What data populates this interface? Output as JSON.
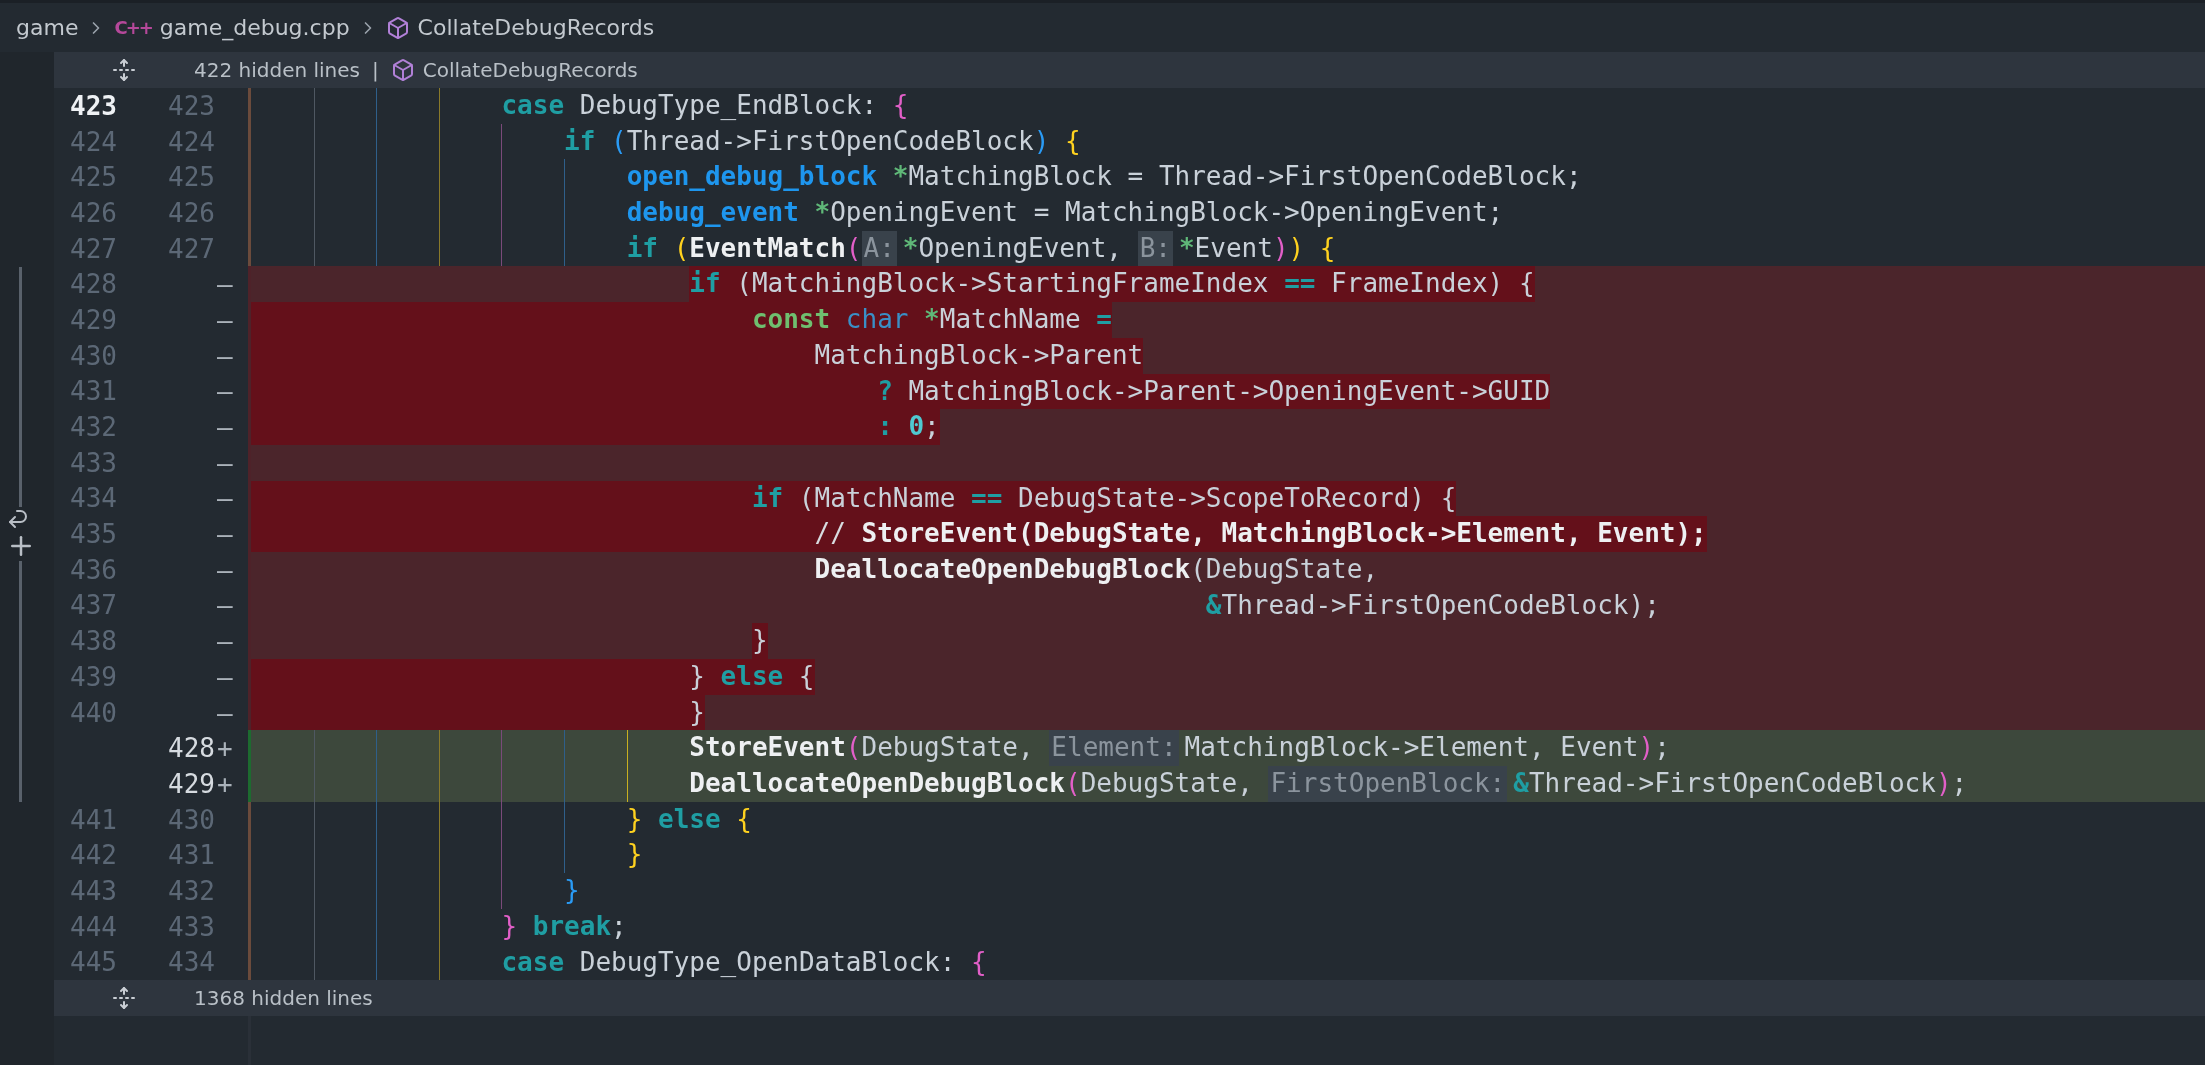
{
  "breadcrumbs": [
    {
      "kind": "folder",
      "text": "game"
    },
    {
      "kind": "file",
      "icon_text": "C++",
      "text": "game_debug.cpp"
    },
    {
      "kind": "symbol",
      "text": "CollateDebugRecords"
    }
  ],
  "top_fold": {
    "label": "422 hidden lines",
    "separator": "|",
    "symbol": "CollateDebugRecords"
  },
  "lines": [
    {
      "kind": "context",
      "old": "423",
      "new": "423",
      "active": true,
      "code": [
        {
          "kind": "keyword",
          "text": "                case"
        },
        {
          "kind": "plain",
          "text": " DebugType_EndBlock: "
        },
        {
          "kind": "bracket-2",
          "text": "{"
        }
      ]
    },
    {
      "kind": "context",
      "old": "424",
      "new": "424",
      "active": false,
      "code": [
        {
          "kind": "keyword",
          "text": "                    if "
        },
        {
          "kind": "bracket-3",
          "text": "("
        },
        {
          "kind": "plain",
          "text": "Thread->FirstOpenCodeBlock"
        },
        {
          "kind": "bracket-3",
          "text": ") "
        },
        {
          "kind": "bracket-1",
          "text": "{"
        }
      ]
    },
    {
      "kind": "context",
      "old": "425",
      "new": "425",
      "active": false,
      "code": [
        {
          "kind": "type",
          "text": "                        open_debug_block "
        },
        {
          "kind": "pointer",
          "text": "*"
        },
        {
          "kind": "plain",
          "text": "MatchingBlock = Thread->FirstOpenCodeBlock;"
        }
      ]
    },
    {
      "kind": "context",
      "old": "426",
      "new": "426",
      "active": false,
      "code": [
        {
          "kind": "type",
          "text": "                        debug_event "
        },
        {
          "kind": "pointer",
          "text": "*"
        },
        {
          "kind": "plain",
          "text": "OpeningEvent = MatchingBlock->OpeningEvent;"
        }
      ]
    },
    {
      "kind": "context",
      "old": "427",
      "new": "427",
      "active": false,
      "code": [
        {
          "kind": "keyword",
          "text": "                        if "
        },
        {
          "kind": "bracket-1",
          "text": "("
        },
        {
          "kind": "function",
          "text": "EventMatch"
        },
        {
          "kind": "bracket-2",
          "text": "("
        },
        {
          "kind": "hint",
          "text": "A:"
        },
        {
          "kind": "pointer",
          "text": "*"
        },
        {
          "kind": "plain",
          "text": "OpeningEvent, "
        },
        {
          "kind": "hint",
          "text": "B:"
        },
        {
          "kind": "pointer",
          "text": "*"
        },
        {
          "kind": "plain",
          "text": "Event"
        },
        {
          "kind": "bracket-2",
          "text": ")"
        },
        {
          "kind": "bracket-1",
          "text": ") {"
        }
      ]
    },
    {
      "kind": "removed",
      "old": "428",
      "sign": "—",
      "active": false,
      "indent_changed": false,
      "code": [
        {
          "kind": "keyword",
          "text": "                            if",
          "changed": true
        },
        {
          "kind": "plain",
          "text": " (MatchingBlock->StartingFrameIndex ",
          "changed": true
        },
        {
          "kind": "operator",
          "text": "==",
          "changed": true
        },
        {
          "kind": "plain",
          "text": " FrameIndex) {",
          "changed": true
        }
      ]
    },
    {
      "kind": "removed",
      "old": "429",
      "sign": "—",
      "active": false,
      "indent_changed": true,
      "code": [
        {
          "kind": "storage",
          "text": "                                const ",
          "changed": true
        },
        {
          "kind": "type-plain",
          "text": "char ",
          "changed": true
        },
        {
          "kind": "pointer",
          "text": "*",
          "changed": true
        },
        {
          "kind": "plain",
          "text": "MatchName ",
          "changed": true
        },
        {
          "kind": "operator",
          "text": "=",
          "changed": true
        }
      ]
    },
    {
      "kind": "removed",
      "old": "430",
      "sign": "—",
      "active": false,
      "indent_changed": true,
      "code": [
        {
          "kind": "plain",
          "text": "                                    MatchingBlock->Parent",
          "changed": true
        }
      ]
    },
    {
      "kind": "removed",
      "old": "431",
      "sign": "—",
      "active": false,
      "indent_changed": true,
      "code": [
        {
          "kind": "operator",
          "text": "                                        ?",
          "changed": true
        },
        {
          "kind": "plain",
          "text": " MatchingBlock->Parent->OpeningEvent->GUID",
          "changed": true
        }
      ]
    },
    {
      "kind": "removed",
      "old": "432",
      "sign": "—",
      "active": false,
      "indent_changed": true,
      "code": [
        {
          "kind": "operator",
          "text": "                                        : ",
          "changed": true
        },
        {
          "kind": "number",
          "text": "0",
          "changed": true
        },
        {
          "kind": "plain",
          "text": ";",
          "changed": true
        }
      ]
    },
    {
      "kind": "removed",
      "old": "433",
      "sign": "—",
      "active": false
    },
    {
      "kind": "removed",
      "old": "434",
      "sign": "—",
      "active": false,
      "indent_changed": true,
      "code": [
        {
          "kind": "keyword",
          "text": "                                if",
          "changed": true
        },
        {
          "kind": "plain",
          "text": " (MatchName ",
          "changed": true
        },
        {
          "kind": "operator",
          "text": "==",
          "changed": true
        },
        {
          "kind": "plain",
          "text": " DebugState->ScopeToRecord) {",
          "changed": true
        }
      ]
    },
    {
      "kind": "removed",
      "old": "435",
      "sign": "—",
      "active": false,
      "indent_changed": true,
      "code": [
        {
          "kind": "comment",
          "text": "                                    // ",
          "changed": true
        },
        {
          "kind": "function",
          "text": "StoreEvent(DebugState, MatchingBlock->Element, Event);",
          "changed": true
        }
      ]
    },
    {
      "kind": "removed",
      "old": "436",
      "sign": "—",
      "active": false,
      "indent_changed": false,
      "code": [
        {
          "kind": "function",
          "text": "                                    DeallocateOpenDebugBlock",
          "changed": false
        },
        {
          "kind": "plain",
          "text": "(DebugState,",
          "changed": false
        }
      ]
    },
    {
      "kind": "removed",
      "old": "437",
      "sign": "—",
      "active": false,
      "indent_changed": false,
      "code": [
        {
          "kind": "operator",
          "text": "                                                             &",
          "changed": false
        },
        {
          "kind": "plain",
          "text": "Thread->FirstOpenCodeBlock);",
          "changed": false
        }
      ]
    },
    {
      "kind": "removed",
      "old": "438",
      "sign": "—",
      "active": false,
      "indent_changed": false,
      "code": [
        {
          "kind": "plain",
          "text": "                                }",
          "changed": true
        }
      ]
    },
    {
      "kind": "removed",
      "old": "439",
      "sign": "—",
      "active": false,
      "indent_changed": true,
      "code": [
        {
          "kind": "plain",
          "text": "                            } ",
          "changed": true
        },
        {
          "kind": "keyword",
          "text": "else",
          "changed": true
        },
        {
          "kind": "plain",
          "text": " {",
          "changed": true
        }
      ]
    },
    {
      "kind": "removed",
      "old": "440",
      "sign": "—",
      "active": false,
      "indent_changed": true,
      "code": [
        {
          "kind": "plain",
          "text": "                            }",
          "changed": true
        }
      ]
    },
    {
      "kind": "added",
      "new": "428",
      "sign": "+",
      "active": false,
      "code": [
        {
          "kind": "function",
          "text": "                            StoreEvent"
        },
        {
          "kind": "bracket-2",
          "text": "("
        },
        {
          "kind": "plain",
          "text": "DebugState, "
        },
        {
          "kind": "hint",
          "text": "Element:"
        },
        {
          "kind": "plain",
          "text": "MatchingBlock->Element, Event"
        },
        {
          "kind": "bracket-2",
          "text": ")"
        },
        {
          "kind": "plain",
          "text": ";"
        }
      ]
    },
    {
      "kind": "added",
      "new": "429",
      "sign": "+",
      "active": false,
      "code": [
        {
          "kind": "function",
          "text": "                            DeallocateOpenDebugBlock"
        },
        {
          "kind": "bracket-2",
          "text": "("
        },
        {
          "kind": "plain",
          "text": "DebugState, "
        },
        {
          "kind": "hint",
          "text": "FirstOpenBlock:"
        },
        {
          "kind": "operator",
          "text": "&"
        },
        {
          "kind": "plain",
          "text": "Thread->FirstOpenCodeBlock"
        },
        {
          "kind": "bracket-2",
          "text": ")"
        },
        {
          "kind": "plain",
          "text": ";"
        }
      ]
    },
    {
      "kind": "context",
      "old": "441",
      "new": "430",
      "active": false,
      "code": [
        {
          "kind": "bracket-1",
          "text": "                        } "
        },
        {
          "kind": "keyword",
          "text": "else "
        },
        {
          "kind": "bracket-1",
          "text": "{"
        }
      ]
    },
    {
      "kind": "context",
      "old": "442",
      "new": "431",
      "active": false,
      "code": [
        {
          "kind": "bracket-1",
          "text": "                        }"
        }
      ]
    },
    {
      "kind": "context",
      "old": "443",
      "new": "432",
      "active": false,
      "code": [
        {
          "kind": "bracket-3",
          "text": "                    }"
        }
      ]
    },
    {
      "kind": "context",
      "old": "444",
      "new": "433",
      "active": false,
      "code": [
        {
          "kind": "bracket-2",
          "text": "                } "
        },
        {
          "kind": "keyword",
          "text": "break"
        },
        {
          "kind": "plain",
          "text": ";"
        }
      ]
    },
    {
      "kind": "context",
      "old": "445",
      "new": "434",
      "active": false,
      "code": [
        {
          "kind": "keyword",
          "text": "                case"
        },
        {
          "kind": "plain",
          "text": " DebugType_OpenDataBlock: "
        },
        {
          "kind": "bracket-2",
          "text": "{"
        }
      ]
    }
  ],
  "bottom_fold": {
    "label": "1368 hidden lines"
  }
}
